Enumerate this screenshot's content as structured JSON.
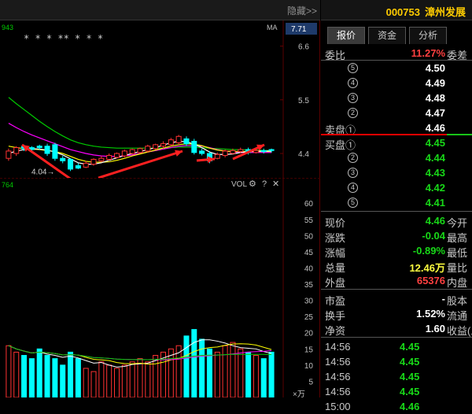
{
  "chart": {
    "hide_label": "隐藏>>",
    "left_tag": "943",
    "ma_label": "MA",
    "price_badge": "7.71",
    "star_markers": "*  *     *   **        *    *        *",
    "price_axis": [
      "6.6",
      "5.5",
      "4.4"
    ],
    "low_marker": "4.04→",
    "vol_left_tag": "764",
    "vol_label": "VOL",
    "vol_icons": [
      "gear-icon",
      "question-icon",
      "close-icon"
    ],
    "vol_axis": [
      "60",
      "55",
      "50",
      "45",
      "40",
      "35",
      "30",
      "25",
      "20",
      "15",
      "10",
      "5"
    ],
    "vol_unit": "×万",
    "colors": {
      "up": "#ff3232",
      "down": "#00ffff",
      "ma5": "#ffffff",
      "ma10": "#ffff00",
      "ma20": "#ff00ff",
      "ma60": "#00cc00",
      "arrow": "#ff2020"
    }
  },
  "chart_data": {
    "type": "candlestick",
    "ylim": [
      3.9,
      6.9
    ],
    "candles": [
      {
        "o": 4.3,
        "c": 4.45,
        "h": 4.5,
        "l": 4.25
      },
      {
        "o": 4.4,
        "c": 4.52,
        "h": 4.55,
        "l": 4.35
      },
      {
        "o": 4.55,
        "c": 4.5,
        "h": 4.58,
        "l": 4.45
      },
      {
        "o": 4.52,
        "c": 4.48,
        "h": 4.55,
        "l": 4.45
      },
      {
        "o": 4.55,
        "c": 4.52,
        "h": 4.58,
        "l": 4.48
      },
      {
        "o": 4.55,
        "c": 4.4,
        "h": 4.6,
        "l": 4.35
      },
      {
        "o": 4.58,
        "c": 4.3,
        "h": 4.62,
        "l": 4.25
      },
      {
        "o": 4.3,
        "c": 4.25,
        "h": 4.35,
        "l": 4.2
      },
      {
        "o": 4.28,
        "c": 4.08,
        "h": 4.3,
        "l": 4.04
      },
      {
        "o": 4.15,
        "c": 4.1,
        "h": 4.2,
        "l": 4.08
      },
      {
        "o": 4.12,
        "c": 4.2,
        "h": 4.25,
        "l": 4.1
      },
      {
        "o": 4.18,
        "c": 4.28,
        "h": 4.3,
        "l": 4.15
      },
      {
        "o": 4.25,
        "c": 4.3,
        "h": 4.35,
        "l": 4.22
      },
      {
        "o": 4.28,
        "c": 4.36,
        "h": 4.4,
        "l": 4.25
      },
      {
        "o": 4.32,
        "c": 4.4,
        "h": 4.42,
        "l": 4.3
      },
      {
        "o": 4.35,
        "c": 4.45,
        "h": 4.48,
        "l": 4.32
      },
      {
        "o": 4.4,
        "c": 4.48,
        "h": 4.5,
        "l": 4.38
      },
      {
        "o": 4.42,
        "c": 4.5,
        "h": 4.52,
        "l": 4.4
      },
      {
        "o": 4.45,
        "c": 4.55,
        "h": 4.58,
        "l": 4.42
      },
      {
        "o": 4.5,
        "c": 4.58,
        "h": 4.6,
        "l": 4.48
      },
      {
        "o": 4.55,
        "c": 4.6,
        "h": 4.65,
        "l": 4.5
      },
      {
        "o": 4.58,
        "c": 4.68,
        "h": 4.72,
        "l": 4.55
      },
      {
        "o": 4.62,
        "c": 4.75,
        "h": 4.78,
        "l": 4.58
      },
      {
        "o": 4.7,
        "c": 4.6,
        "h": 4.75,
        "l": 4.55
      },
      {
        "o": 4.65,
        "c": 4.42,
        "h": 4.7,
        "l": 4.38
      },
      {
        "o": 4.45,
        "c": 4.4,
        "h": 4.5,
        "l": 4.36
      },
      {
        "o": 4.4,
        "c": 4.25,
        "h": 4.45,
        "l": 4.2
      },
      {
        "o": 4.3,
        "c": 4.38,
        "h": 4.42,
        "l": 4.28
      },
      {
        "o": 4.36,
        "c": 4.45,
        "h": 4.48,
        "l": 4.32
      },
      {
        "o": 4.4,
        "c": 4.46,
        "h": 4.5,
        "l": 4.38
      },
      {
        "o": 4.44,
        "c": 4.48,
        "h": 4.52,
        "l": 4.4
      },
      {
        "o": 4.48,
        "c": 4.42,
        "h": 4.52,
        "l": 4.38
      },
      {
        "o": 4.42,
        "c": 4.46,
        "h": 4.5,
        "l": 4.4
      },
      {
        "o": 4.46,
        "c": 4.44,
        "h": 4.5,
        "l": 4.4
      },
      {
        "o": 4.48,
        "c": 4.46,
        "h": 4.5,
        "l": 4.42
      }
    ],
    "ma_series": [
      {
        "key": "ma60",
        "values": [
          5.55,
          5.42,
          5.3,
          5.18,
          5.06,
          4.95,
          4.85,
          4.76,
          4.68,
          4.62,
          4.58,
          4.55,
          4.53,
          4.52,
          4.51,
          4.51,
          4.51,
          4.51,
          4.51,
          4.51,
          4.51,
          4.52,
          4.53,
          4.53,
          4.53,
          4.52,
          4.51,
          4.5,
          4.49,
          4.48,
          4.48,
          4.47,
          4.47,
          4.46,
          4.46
        ]
      },
      {
        "key": "ma20",
        "values": [
          5.02,
          4.93,
          4.85,
          4.78,
          4.72,
          4.66,
          4.6,
          4.54,
          4.48,
          4.44,
          4.4,
          4.37,
          4.35,
          4.34,
          4.34,
          4.35,
          4.37,
          4.4,
          4.43,
          4.46,
          4.49,
          4.52,
          4.55,
          4.56,
          4.56,
          4.55,
          4.52,
          4.48,
          4.45,
          4.43,
          4.42,
          4.42,
          4.42,
          4.42,
          4.42
        ]
      },
      {
        "key": "ma10",
        "values": [
          4.55,
          4.52,
          4.5,
          4.49,
          4.48,
          4.46,
          4.44,
          4.4,
          4.34,
          4.28,
          4.24,
          4.22,
          4.22,
          4.23,
          4.26,
          4.3,
          4.35,
          4.39,
          4.43,
          4.47,
          4.51,
          4.55,
          4.58,
          4.6,
          4.59,
          4.56,
          4.51,
          4.47,
          4.45,
          4.44,
          4.44,
          4.44,
          4.44,
          4.44,
          4.44
        ]
      },
      {
        "key": "ma5",
        "values": [
          4.4,
          4.45,
          4.48,
          4.5,
          4.49,
          4.47,
          4.43,
          4.37,
          4.29,
          4.21,
          4.18,
          4.18,
          4.21,
          4.26,
          4.31,
          4.36,
          4.4,
          4.44,
          4.48,
          4.52,
          4.57,
          4.62,
          4.65,
          4.64,
          4.59,
          4.52,
          4.43,
          4.38,
          4.38,
          4.39,
          4.42,
          4.44,
          4.45,
          4.45,
          4.45
        ]
      }
    ],
    "volume_ylim": [
      0,
      62
    ],
    "volume": [
      16,
      14,
      13,
      12,
      15,
      13,
      12,
      10,
      14,
      12,
      9,
      8,
      11,
      10,
      9,
      10,
      11,
      12,
      11,
      13,
      14,
      15,
      16,
      19,
      21,
      18,
      15,
      14,
      16,
      17,
      15,
      14,
      13,
      12,
      14
    ]
  },
  "panel": {
    "code": "000753",
    "name": "漳州发展",
    "tabs": [
      "报价",
      "资金",
      "分析"
    ],
    "weibi_label": "委比",
    "weibi_value": "11.27%",
    "weicha_label": "委差",
    "sell_label": "卖盘①",
    "buy_label": "买盘①",
    "sell": [
      {
        "n": "⑤",
        "p": "4.50"
      },
      {
        "n": "④",
        "p": "4.49"
      },
      {
        "n": "③",
        "p": "4.48"
      },
      {
        "n": "②",
        "p": "4.47"
      },
      {
        "n": "",
        "p": "4.46"
      }
    ],
    "buy": [
      {
        "n": "",
        "p": "4.45"
      },
      {
        "n": "②",
        "p": "4.44"
      },
      {
        "n": "③",
        "p": "4.43"
      },
      {
        "n": "④",
        "p": "4.42"
      },
      {
        "n": "⑤",
        "p": "4.41"
      }
    ],
    "stats": [
      {
        "l": "现价",
        "v": "4.46",
        "r": "今开",
        "c": "#18d818"
      },
      {
        "l": "涨跌",
        "v": "-0.04",
        "r": "最高",
        "c": "#18d818"
      },
      {
        "l": "涨幅",
        "v": "-0.89%",
        "r": "最低",
        "c": "#18d818"
      },
      {
        "l": "总量",
        "v": "12.46万",
        "r": "量比",
        "c": "#ffff40"
      },
      {
        "l": "外盘",
        "v": "65376",
        "r": "内盘",
        "c": "#ff4040"
      }
    ],
    "stats2": [
      {
        "l": "市盈",
        "v": "-",
        "r": "股本"
      },
      {
        "l": "换手",
        "v": "1.52%",
        "r": "流通"
      },
      {
        "l": "净资",
        "v": "1.60",
        "r": "收益(三"
      }
    ],
    "ticks": [
      {
        "t": "14:56",
        "p": "4.45"
      },
      {
        "t": "14:56",
        "p": "4.45"
      },
      {
        "t": "14:56",
        "p": "4.45"
      },
      {
        "t": "14:56",
        "p": "4.45"
      },
      {
        "t": "15:00",
        "p": "4.46"
      }
    ]
  }
}
